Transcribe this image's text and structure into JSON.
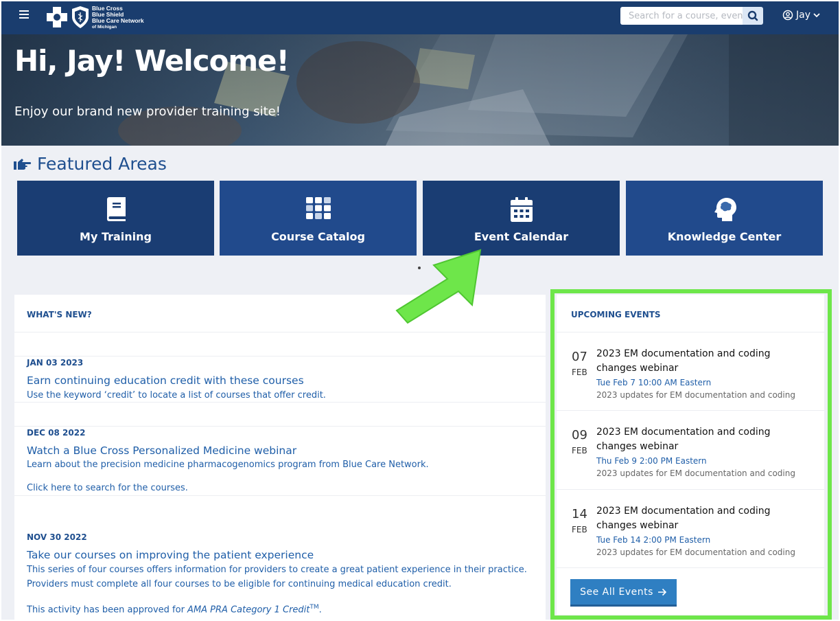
{
  "header": {
    "logo_lines": [
      "Blue Cross",
      "Blue Shield",
      "Blue Care Network",
      "of Michigan"
    ],
    "search_placeholder": "Search for a course, event",
    "user_name": "Jay"
  },
  "hero": {
    "title": "Hi, Jay! Welcome!",
    "subtitle": "Enjoy our brand new provider training site!"
  },
  "featured": {
    "title": "Featured Areas",
    "tiles": [
      {
        "label": "My Training",
        "icon": "book-icon"
      },
      {
        "label": "Course Catalog",
        "icon": "grid-icon"
      },
      {
        "label": "Event Calendar",
        "icon": "calendar-icon"
      },
      {
        "label": "Knowledge Center",
        "icon": "brain-head-icon"
      }
    ]
  },
  "whats_new": {
    "heading": "WHAT'S NEW?",
    "items": [
      {
        "date": "JAN 03 2023",
        "title": "Earn continuing education credit with these courses",
        "text": "Use the keyword ‘credit’ to locate a list of courses that offer credit."
      },
      {
        "date": "DEC 08 2022",
        "title": "Watch a Blue Cross Personalized Medicine webinar",
        "text": "Learn about the precision medicine pharmacogenomics program from Blue Care Network.",
        "link": "Click here to search for the courses."
      },
      {
        "date": "NOV 30 2022",
        "title": "Take our courses on improving the patient experience",
        "text1": "This series of four courses offers information for providers to create a great patient experience in their practice.",
        "text2": "Providers must complete all four courses to be eligible for continuing medical education credit.",
        "note_prefix": "This activity has been approved for ",
        "note_italic": "AMA PRA Category 1 Credit",
        "note_sup": "TM",
        "note_suffix": "."
      }
    ]
  },
  "events": {
    "heading": "UPCOMING EVENTS",
    "items": [
      {
        "day": "07",
        "month": "FEB",
        "title": "2023 EM documentation and coding changes webinar",
        "when": "Tue Feb 7 10:00 AM Eastern",
        "desc": "2023 updates for EM documentation and coding"
      },
      {
        "day": "09",
        "month": "FEB",
        "title": "2023 EM documentation and coding changes webinar",
        "when": "Thu Feb 9 2:00 PM Eastern",
        "desc": "2023 updates for EM documentation and coding"
      },
      {
        "day": "14",
        "month": "FEB",
        "title": "2023 EM documentation and coding changes webinar",
        "when": "Tue Feb 14 2:00 PM Eastern",
        "desc": "2023 updates for EM documentation and coding"
      }
    ],
    "see_all": "See All Events"
  },
  "colors": {
    "header_bg": "#1a3d6e",
    "tile_bg": "#1a3d73",
    "accent": "#1f5ea8",
    "highlight": "#6ee64a"
  }
}
